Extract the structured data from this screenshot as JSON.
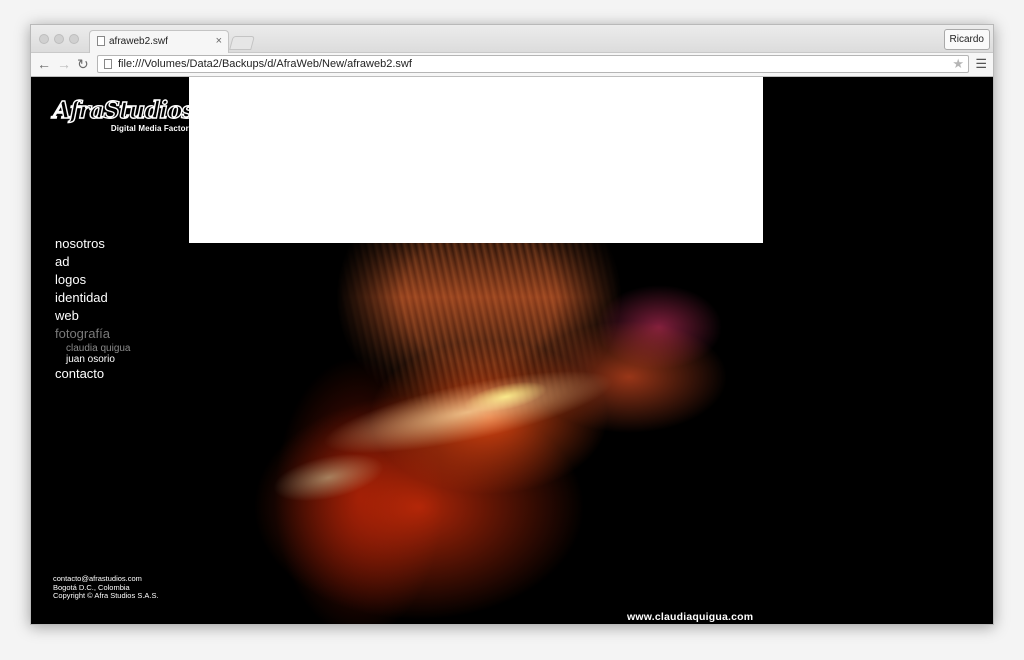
{
  "browser": {
    "tab_title": "afraweb2.swf",
    "tab_close": "×",
    "profile_name": "Ricardo",
    "url": "file:///Volumes/Data2/Backups/d/AfraWeb/New/afraweb2.swf",
    "back_icon": "arrow-left",
    "forward_icon": "arrow-right",
    "reload_icon": "reload",
    "star_icon": "star",
    "menu_icon": "hamburger"
  },
  "site": {
    "logo_text": "AfraStudios",
    "logo_subtitle": "Digital Media Factory",
    "nav": [
      {
        "label": "nosotros"
      },
      {
        "label": "ad"
      },
      {
        "label": "logos"
      },
      {
        "label": "identidad"
      },
      {
        "label": "web"
      },
      {
        "label": "fotografía"
      }
    ],
    "subnav": [
      {
        "label": "claudia quigua"
      },
      {
        "label": "juan osorio"
      }
    ],
    "nav_last": "contacto",
    "footer": {
      "email": "contacto@afrastudios.com",
      "city": "Bogotá D.C., Colombia",
      "copyright": "Copyright © Afra Studios S.A.S."
    },
    "photo_credit": "www.claudiaquigua.com"
  },
  "colors": {
    "background": "#000000",
    "text": "#ffffff",
    "dim_text": "#7a7a7a",
    "photo_accent": "#ff5014"
  }
}
